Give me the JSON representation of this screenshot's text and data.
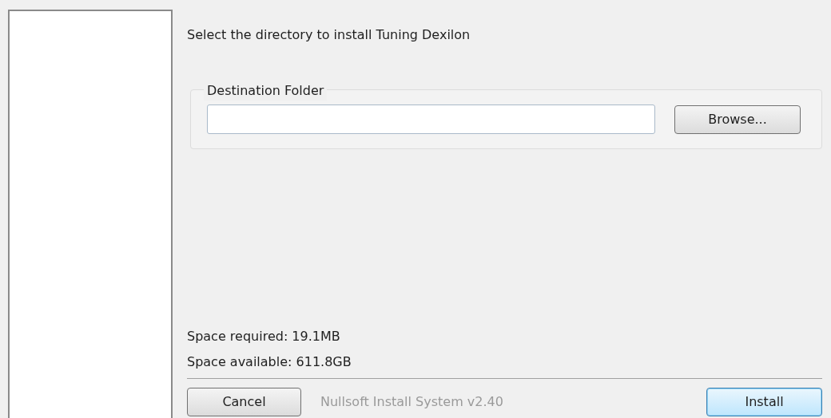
{
  "heading": "Select the directory to install Tuning Dexilon",
  "destination": {
    "legend": "Destination Folder",
    "browse": {
      "label": "Browse...",
      "default": false
    }
  },
  "space": [
    "Space required: 19.1MB",
    "Space available: 611.8GB"
  ],
  "branding": "Nullsoft Install System v2.40",
  "buttons": [
    {
      "label": "Cancel",
      "default": false
    },
    {
      "label": "Install",
      "default": true
    }
  ]
}
